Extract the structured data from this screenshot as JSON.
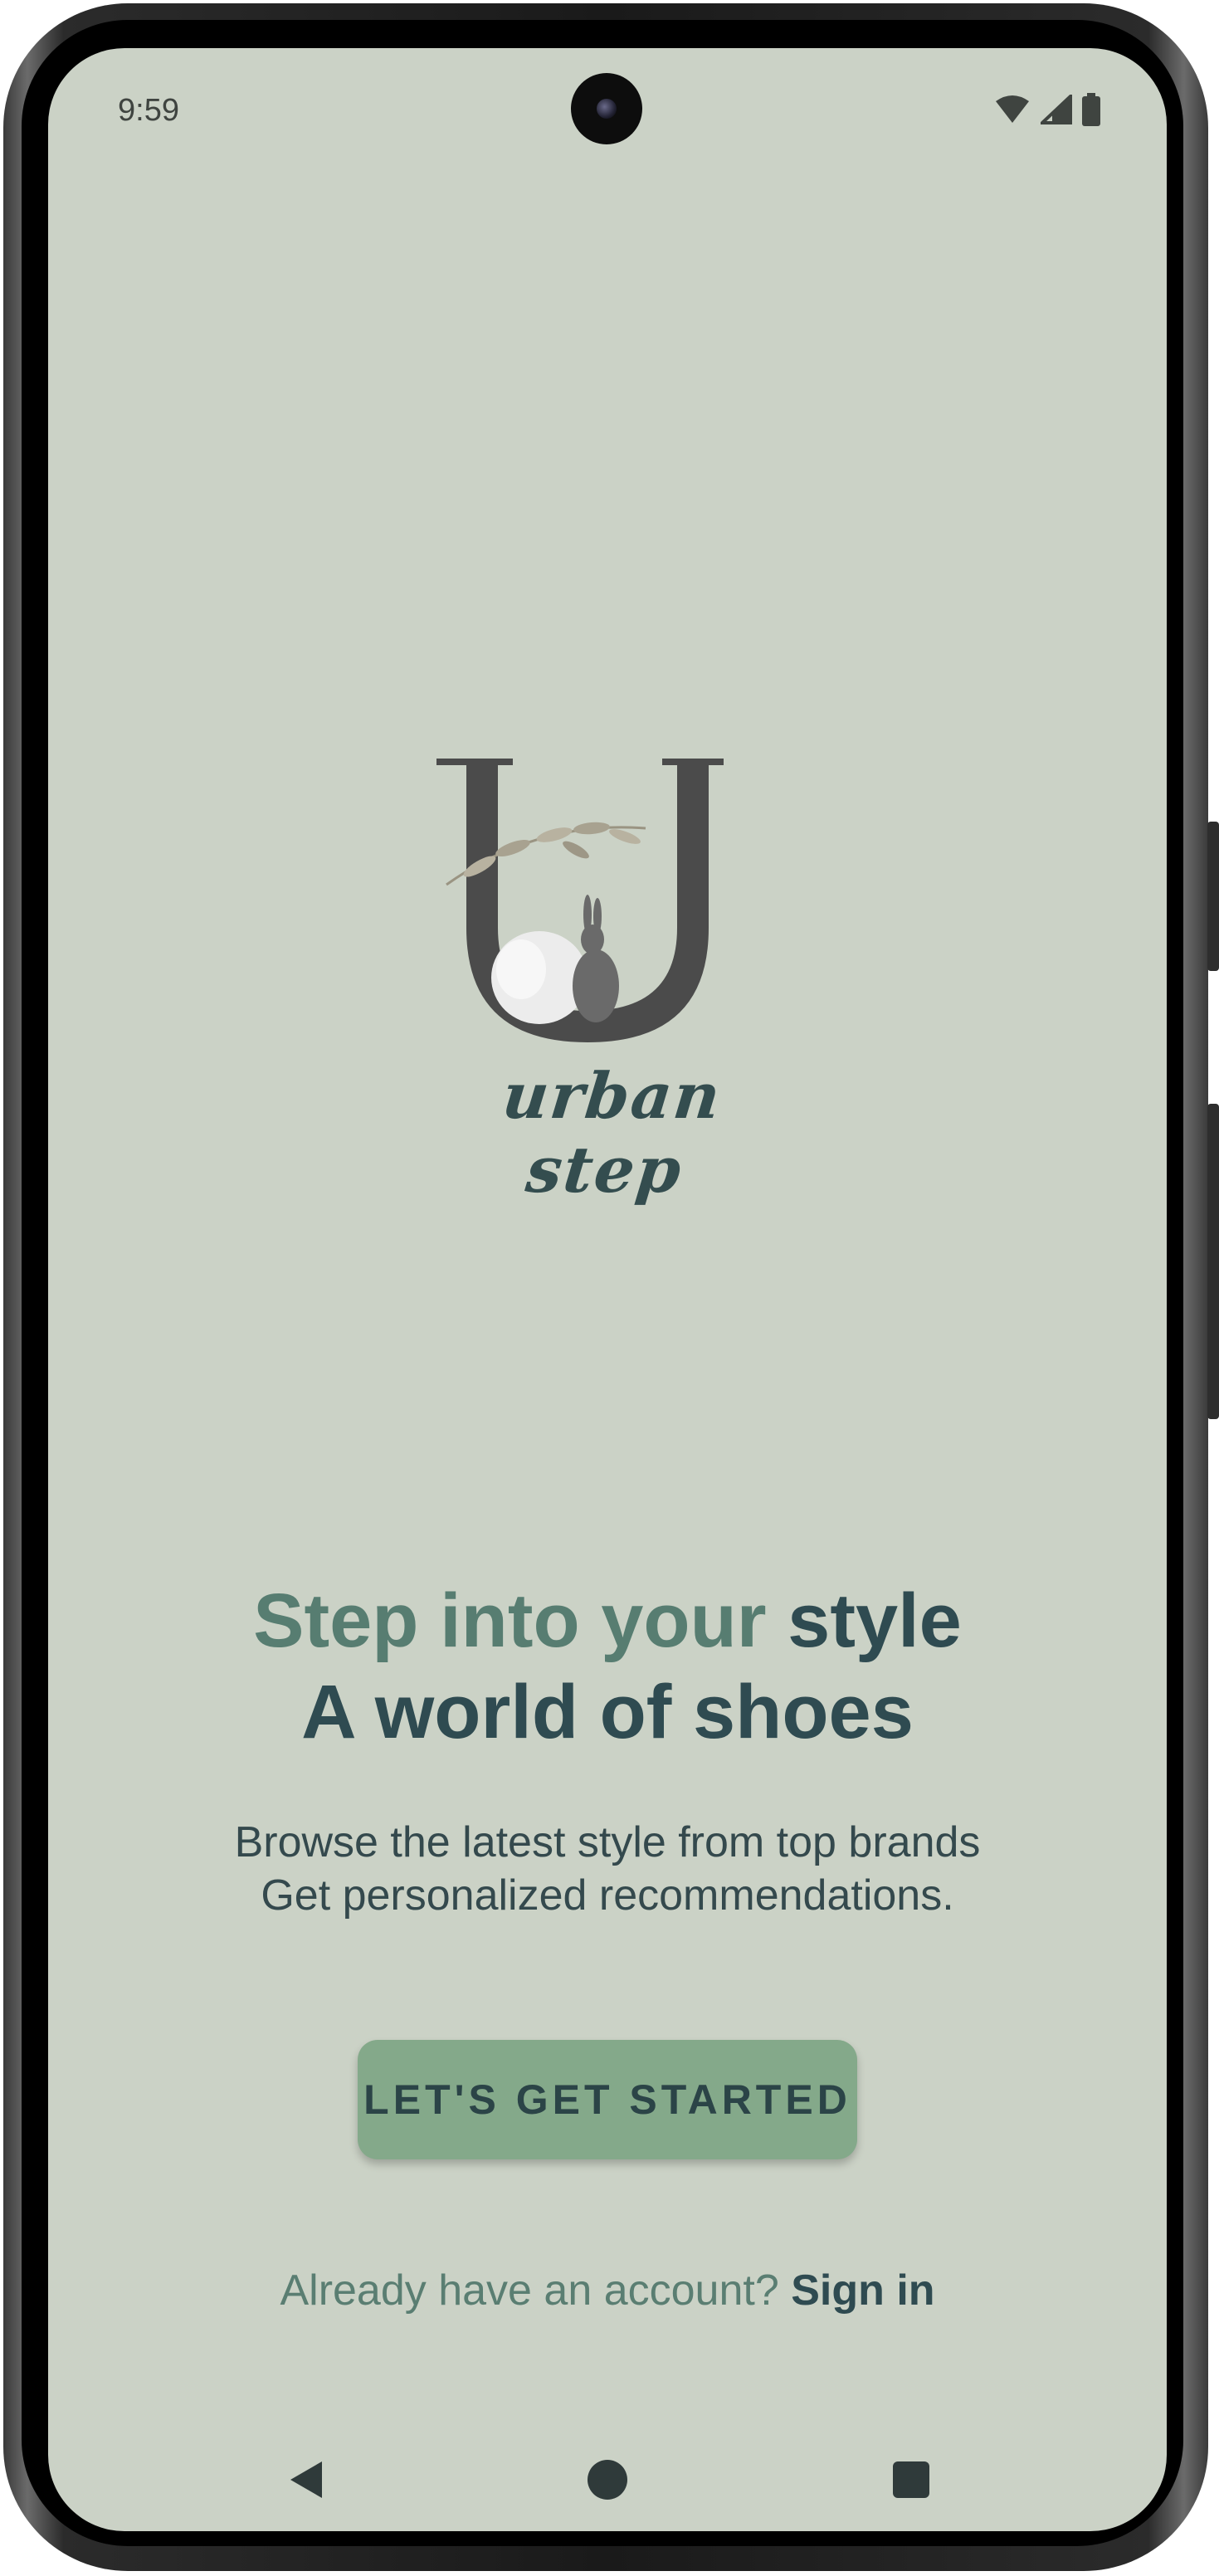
{
  "status_bar": {
    "time": "9:59",
    "icons": [
      "wifi-icon",
      "cell-signal-icon",
      "battery-icon"
    ]
  },
  "logo": {
    "monogram": "U",
    "wordmark": "urban step"
  },
  "headline": {
    "line1_accent": "Step into your",
    "line1_rest": "style",
    "line2": "A world of shoes"
  },
  "subtext": {
    "line1": "Browse the latest style from top brands",
    "line2": "Get personalized recommendations."
  },
  "cta": {
    "label": "Let's get started"
  },
  "signin": {
    "prompt": "Already have an account?",
    "link": "Sign in"
  },
  "nav": {
    "items": [
      "back-icon",
      "home-icon",
      "recents-icon"
    ]
  },
  "colors": {
    "background": "#cbd2c6",
    "accent": "#577d71",
    "primary_text": "#2f4b51",
    "button": "#84a98a"
  }
}
